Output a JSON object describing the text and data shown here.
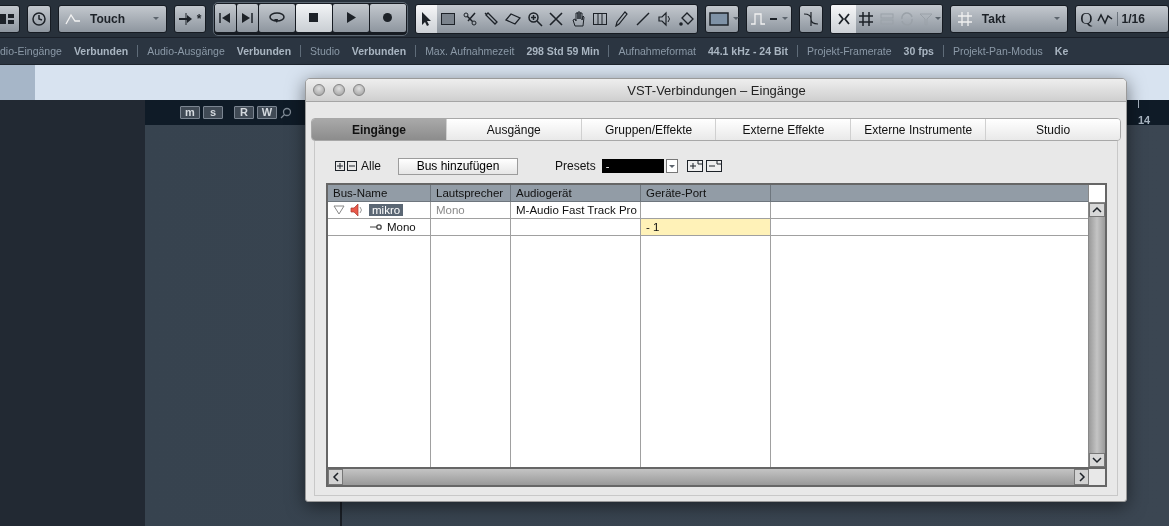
{
  "toolbar": {
    "automation_mode": "Touch",
    "automation_marker": "*",
    "stop_active": true,
    "tools": [
      {
        "selected": true
      },
      {
        "selected": false
      },
      {
        "selected": false
      },
      {
        "selected": false
      },
      {
        "selected": false
      },
      {
        "selected": false
      },
      {
        "selected": false
      },
      {
        "selected": false
      },
      {
        "selected": false
      },
      {
        "selected": false
      },
      {
        "selected": false
      },
      {
        "selected": false
      },
      {
        "selected": false
      }
    ],
    "snap_on": true,
    "grid_type": "Takt",
    "quantize_label": "Q",
    "quantize_value": "1/16"
  },
  "status_bar": [
    {
      "label": "dio-Eingänge",
      "value": "Verbunden"
    },
    {
      "label": "Audio-Ausgänge",
      "value": "Verbunden"
    },
    {
      "label": "Studio",
      "value": "Verbunden"
    },
    {
      "label": "Max. Aufnahmezeit",
      "value": "298 Std 59 Min"
    },
    {
      "label": "Aufnahmeformat",
      "value": "44.1 kHz - 24 Bit"
    },
    {
      "label": "Projekt-Framerate",
      "value": "30 fps"
    },
    {
      "label": "Projekt-Pan-Modus",
      "value": "Ke"
    }
  ],
  "arranger": {
    "track_buttons": [
      "m",
      "s",
      "R",
      "W"
    ],
    "ruler_label": "14"
  },
  "dialog": {
    "title": "VST-Verbindungen – Eingänge",
    "tabs": [
      {
        "label": "Eingänge",
        "selected": true
      },
      {
        "label": "Ausgänge",
        "selected": false
      },
      {
        "label": "Gruppen/Effekte",
        "selected": false
      },
      {
        "label": "Externe Effekte",
        "selected": false
      },
      {
        "label": "Externe Instrumente",
        "selected": false
      },
      {
        "label": "Studio",
        "selected": false
      }
    ],
    "expand_all_label": "Alle",
    "add_bus_button": "Bus hinzufügen",
    "presets_label": "Presets",
    "preset_value": "-",
    "columns": [
      "Bus-Name",
      "Lautsprecher",
      "Audiogerät",
      "Geräte-Port"
    ],
    "buses": [
      {
        "name": "mikro",
        "selected": true,
        "expanded": true,
        "speaker": "Mono",
        "device": "M-Audio Fast Track Pro",
        "children": [
          {
            "name": "Mono",
            "port": "- 1",
            "selected": true
          }
        ]
      }
    ]
  }
}
